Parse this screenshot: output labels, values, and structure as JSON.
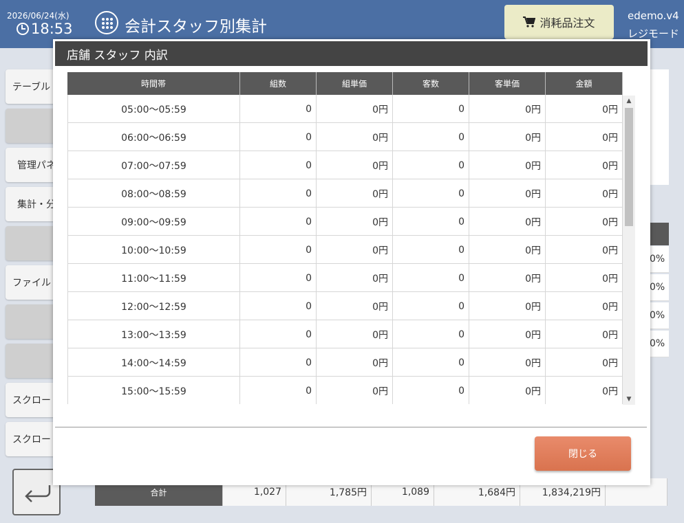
{
  "header": {
    "date": "2026/06/24(水)",
    "time": "18:53",
    "title": "会計スタッフ別集計",
    "order_button": "消耗品注文",
    "user": "edemo.v4",
    "mode": "レジモード"
  },
  "sidebar": {
    "items": [
      "テーブル",
      "",
      "管理パネ",
      "集計・分",
      "",
      "ファイル",
      "",
      "",
      "スクロー",
      "スクロー"
    ]
  },
  "background": {
    "percent_cells": [
      "0%",
      "0%",
      "0%",
      "0%"
    ],
    "totals": {
      "label": "合計",
      "values": [
        "1,027",
        "1,785円",
        "1,089",
        "1,684円",
        "1,834,219円",
        ""
      ]
    }
  },
  "modal": {
    "title": "店舗 スタッフ 内訳",
    "columns": [
      "時間帯",
      "組数",
      "組単価",
      "客数",
      "客単価",
      "金額"
    ],
    "rows": [
      [
        "05:00～05:59",
        "0",
        "0円",
        "0",
        "0円",
        "0円"
      ],
      [
        "06:00～06:59",
        "0",
        "0円",
        "0",
        "0円",
        "0円"
      ],
      [
        "07:00～07:59",
        "0",
        "0円",
        "0",
        "0円",
        "0円"
      ],
      [
        "08:00～08:59",
        "0",
        "0円",
        "0",
        "0円",
        "0円"
      ],
      [
        "09:00～09:59",
        "0",
        "0円",
        "0",
        "0円",
        "0円"
      ],
      [
        "10:00～10:59",
        "0",
        "0円",
        "0",
        "0円",
        "0円"
      ],
      [
        "11:00～11:59",
        "0",
        "0円",
        "0",
        "0円",
        "0円"
      ],
      [
        "12:00～12:59",
        "0",
        "0円",
        "0",
        "0円",
        "0円"
      ],
      [
        "13:00～13:59",
        "0",
        "0円",
        "0",
        "0円",
        "0円"
      ],
      [
        "14:00～14:59",
        "0",
        "0円",
        "0",
        "0円",
        "0円"
      ],
      [
        "15:00～15:59",
        "0",
        "0円",
        "0",
        "0円",
        "0円"
      ]
    ],
    "close_button": "閉じる"
  },
  "colors": {
    "header_bg": "#4b6fa4",
    "modal_title_bg": "#444444",
    "table_header_bg": "#595959",
    "close_button": "#e0805c",
    "order_button": "#ebebc7"
  }
}
